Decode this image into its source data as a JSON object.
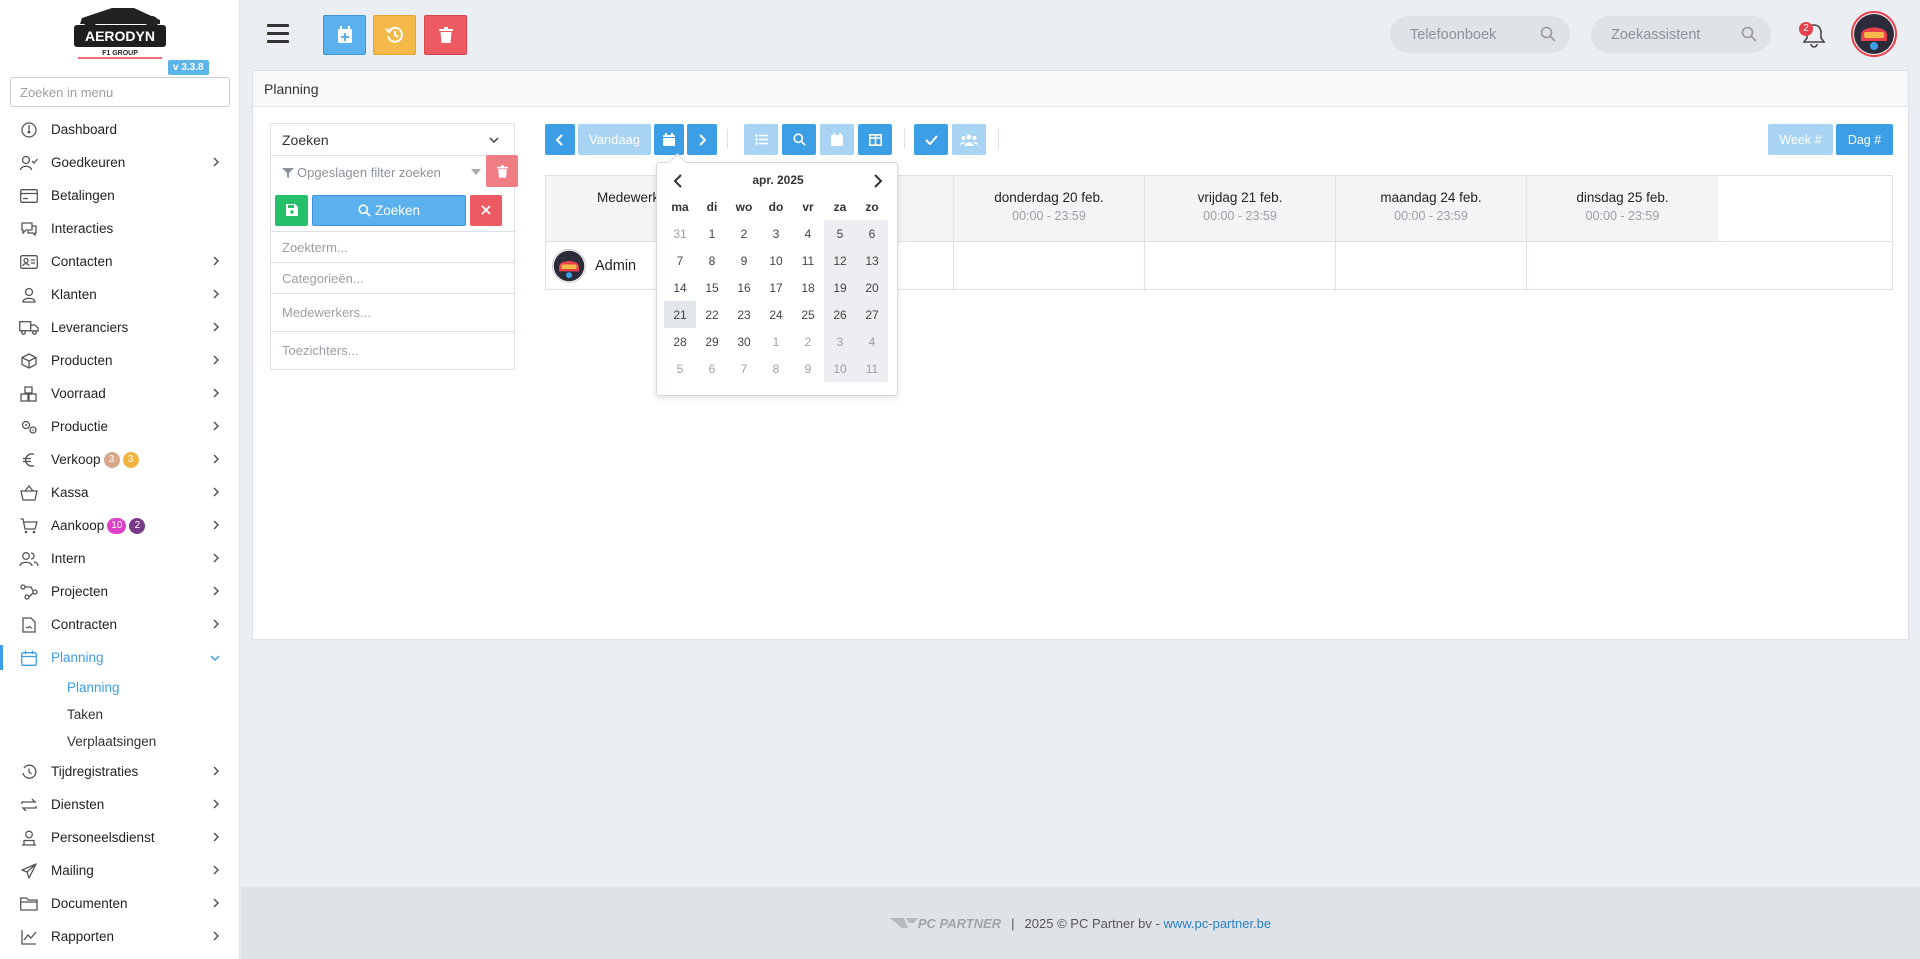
{
  "sidebar": {
    "version": "v 3.3.8",
    "logo_text": "AERODYN",
    "logo_sub": "F1 GROUP",
    "search_placeholder": "Zoeken in menu",
    "items": [
      {
        "label": "Dashboard",
        "icon": "dashboard-icon",
        "chevron": false
      },
      {
        "label": "Goedkeuren",
        "icon": "user-check-icon",
        "chevron": true
      },
      {
        "label": "Betalingen",
        "icon": "credit-card-icon",
        "chevron": false
      },
      {
        "label": "Interacties",
        "icon": "chat-icon",
        "chevron": false
      },
      {
        "label": "Contacten",
        "icon": "contact-card-icon",
        "chevron": true
      },
      {
        "label": "Klanten",
        "icon": "user-icon",
        "chevron": true
      },
      {
        "label": "Leveranciers",
        "icon": "truck-icon",
        "chevron": true
      },
      {
        "label": "Producten",
        "icon": "box-icon",
        "chevron": true
      },
      {
        "label": "Voorraad",
        "icon": "boxes-icon",
        "chevron": true
      },
      {
        "label": "Productie",
        "icon": "gears-icon",
        "chevron": true
      },
      {
        "label": "Verkoop",
        "icon": "euro-icon",
        "chevron": true,
        "badges": [
          {
            "text": "3",
            "color": "#d8a68a"
          },
          {
            "text": "3",
            "color": "#f2b441"
          }
        ]
      },
      {
        "label": "Kassa",
        "icon": "basket-icon",
        "chevron": true
      },
      {
        "label": "Aankoop",
        "icon": "cart-icon",
        "chevron": true,
        "badges": [
          {
            "text": "10",
            "color": "#e040c8"
          },
          {
            "text": "2",
            "color": "#7a3a8a"
          }
        ]
      },
      {
        "label": "Intern",
        "icon": "users-icon",
        "chevron": true
      },
      {
        "label": "Projecten",
        "icon": "project-icon",
        "chevron": true
      },
      {
        "label": "Contracten",
        "icon": "contract-icon",
        "chevron": true
      },
      {
        "label": "Planning",
        "icon": "calendar-icon",
        "chevron": true,
        "active": true
      }
    ],
    "planning_sub": [
      "Planning",
      "Taken",
      "Verplaatsingen"
    ],
    "items_after": [
      {
        "label": "Tijdregistraties",
        "icon": "clock-icon"
      },
      {
        "label": "Diensten",
        "icon": "repeat-icon"
      },
      {
        "label": "Personeelsdienst",
        "icon": "person-badge-icon"
      },
      {
        "label": "Mailing",
        "icon": "send-icon"
      },
      {
        "label": "Documenten",
        "icon": "folder-icon"
      },
      {
        "label": "Rapporten",
        "icon": "chart-line-icon"
      }
    ]
  },
  "topbar": {
    "phonebook_placeholder": "Telefoonboek",
    "assistant_placeholder": "Zoekassistent",
    "notification_count": "2",
    "colors": {
      "blue": "#5bb1ee",
      "orange": "#f5b94a",
      "red": "#ee5a62"
    }
  },
  "page": {
    "title": "Planning"
  },
  "filter": {
    "search_select": "Zoeken",
    "saved_filter_placeholder": "Opgeslagen filter zoeken",
    "search_button": "Zoeken",
    "term_placeholder": "Zoekterm...",
    "categories_placeholder": "Categorieën...",
    "employees_placeholder": "Medewerkers...",
    "supervisors_placeholder": "Toezichters..."
  },
  "calendar": {
    "today_label": "Vandaag",
    "week_label": "Week #",
    "day_label": "Dag #",
    "employee_header": "Medewerk",
    "columns": [
      {
        "day": "donderdag 20 feb.",
        "time": "00:00 - 23:59"
      },
      {
        "day": "vrijdag 21 feb.",
        "time": "00:00 - 23:59"
      },
      {
        "day": "maandag 24 feb.",
        "time": "00:00 - 23:59"
      },
      {
        "day": "dinsdag 25 feb.",
        "time": "00:00 - 23:59"
      }
    ],
    "rows": [
      {
        "name": "Admin"
      }
    ]
  },
  "datepicker": {
    "month_title": "apr. 2025",
    "weekdays": [
      "ma",
      "di",
      "wo",
      "do",
      "vr",
      "za",
      "zo"
    ],
    "weeks": [
      [
        "31",
        "1",
        "2",
        "3",
        "4",
        "5",
        "6"
      ],
      [
        "7",
        "8",
        "9",
        "10",
        "11",
        "12",
        "13"
      ],
      [
        "14",
        "15",
        "16",
        "17",
        "18",
        "19",
        "20"
      ],
      [
        "21",
        "22",
        "23",
        "24",
        "25",
        "26",
        "27"
      ],
      [
        "28",
        "29",
        "30",
        "1",
        "2",
        "3",
        "4"
      ],
      [
        "5",
        "6",
        "7",
        "8",
        "9",
        "10",
        "11"
      ]
    ]
  },
  "footer": {
    "brand": "PC PARTNER",
    "separator": "|",
    "copyright": "2025 © PC Partner bv - ",
    "link": "www.pc-partner.be"
  }
}
